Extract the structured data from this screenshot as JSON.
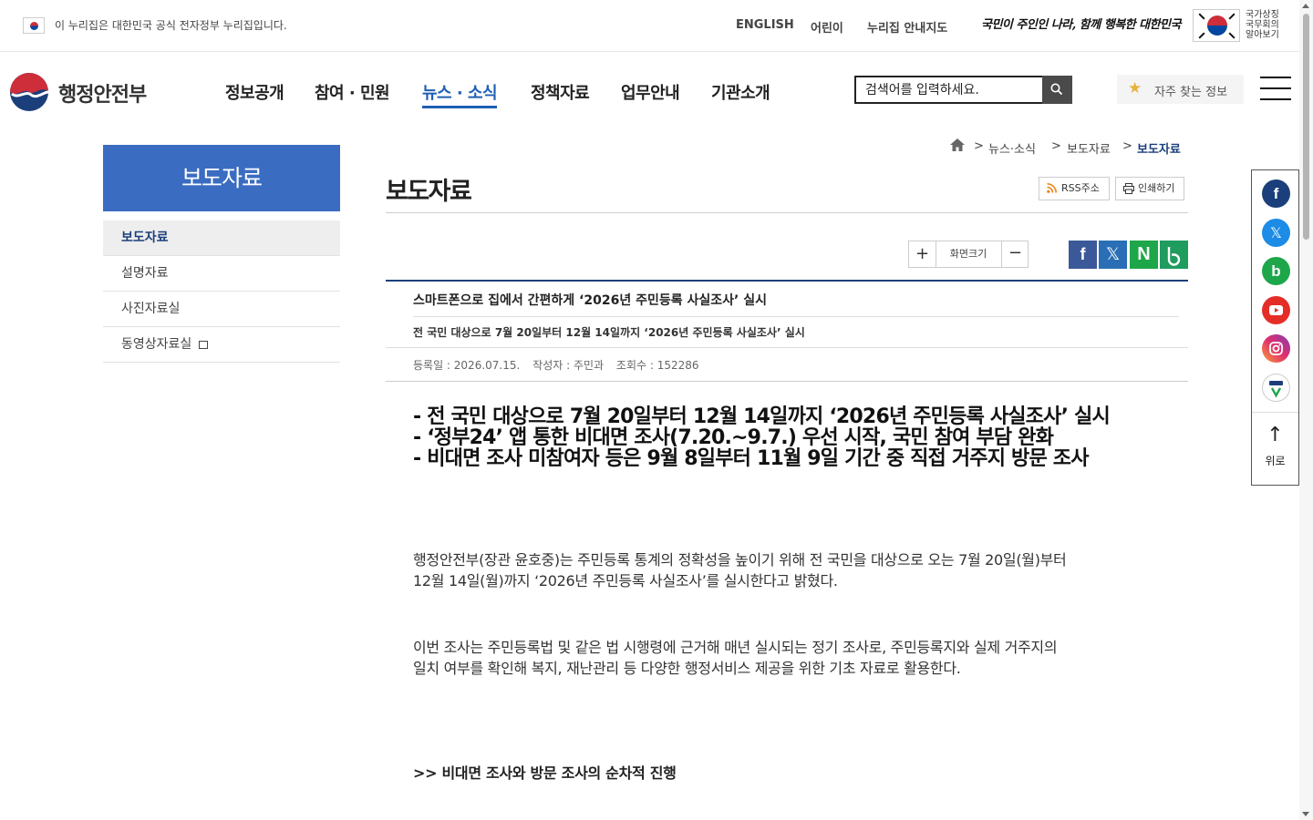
{
  "gov_banner": {
    "text": "이 누리집은 대한민국 공식 전자정부 누리집입니다."
  },
  "util_links": [
    "ENGLISH",
    "어린이",
    "누리집 안내지도"
  ],
  "slogan": "국민이 주인인 나라, 함께 행복한 대한민국",
  "symbol_text": "국가상징 국무회의 알아보기",
  "logo": {
    "text": "행정안전부"
  },
  "gnb": [
    "정보공개",
    "참여 · 민원",
    "뉴스 · 소식",
    "정책자료",
    "업무안내",
    "기관소개"
  ],
  "gnb_active": "뉴스 · 소식",
  "search": {
    "placeholder": "검색어를 입력하세요."
  },
  "faq_button": "자주 찾는 정보",
  "lnb": {
    "title": "보도자료",
    "items": [
      "보도자료",
      "설명자료",
      "사진자료실",
      "동영상자료실"
    ]
  },
  "breadcrumb": [
    "뉴스·소식",
    "보도자료",
    "보도자료"
  ],
  "page_title": "보도자료",
  "tools": {
    "rss": "RSS주소",
    "print": "인쇄하기"
  },
  "zoom": {
    "plus": "+",
    "label": "화면크기",
    "minus": "−"
  },
  "share_icons": [
    "facebook-icon",
    "x-icon",
    "naver-icon",
    "band-icon"
  ],
  "article": {
    "title": "스마트폰으로 집에서 간편하게 ‘2026년 주민등록 사실조사’ 실시",
    "subtitle": "전 국민 대상으로 7월 20일부터 12월 14일까지 ‘2026년 주민등록 사실조사’ 실시",
    "meta": {
      "date": "등록일 : 2026.07.15.",
      "author": "작성자 : 주민과",
      "views": "조회수 : 152286"
    },
    "summary": [
      "- 전 국민 대상으로 7월 20일부터 12월 14일까지 ‘2026년 주민등록 사실조사’ 실시",
      "- ‘정부24’ 앱 통한 비대면 조사(7.20.~9.7.) 우선 시작, 국민 참여 부담 완화",
      "- 비대면 조사 미참여자 등은 9월 8일부터 11월 9일 기간 중 직접 거주지 방문 조사"
    ],
    "paragraphs": [
      [
        "행정안전부(장관 윤호중)는 주민등록 통계의 정확성을 높이기 위해 전 국민을 대상으로 오는 7월 20일(월)부터",
        "12월 14일(월)까지 ‘2026년 주민등록 사실조사’를 실시한다고 밝혔다."
      ],
      [
        "이번 조사는 주민등록법 및 같은 법 시행령에 근거해 매년 실시되는 정기 조사로, 주민등록지와 실제 거주지의",
        "일치 여부를 확인해 복지, 재난관리 등 다양한 행정서비스 제공을 위한 기초 자료로 활용한다."
      ]
    ],
    "subhead": ">> 비대면 조사와 방문 조사의 순차적 진행"
  },
  "quick_menu": {
    "icons": [
      "facebook-icon",
      "x-icon",
      "band-icon",
      "youtube-icon",
      "instagram-icon",
      "tv-icon"
    ],
    "top_label": "위로"
  },
  "colors": {
    "primary": "#1f5fb4",
    "lnb_title_bg": "#3a6cc2",
    "accent_line": "#1b3f7a"
  }
}
